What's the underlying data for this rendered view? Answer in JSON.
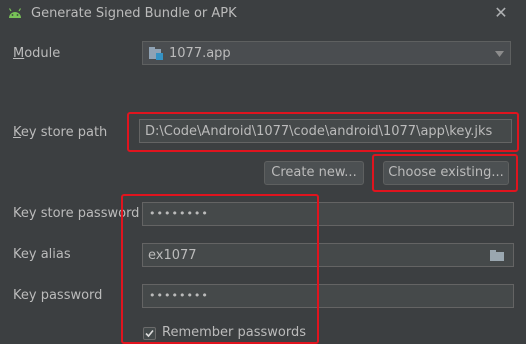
{
  "window": {
    "title": "Generate Signed Bundle or APK"
  },
  "module": {
    "label": "Module",
    "value": "1077.app"
  },
  "keystore": {
    "path_label": "Key store path",
    "path_value": "D:\\Code\\Android\\1077\\code\\android\\1077\\app\\key.jks",
    "create_new": "Create new...",
    "choose_existing": "Choose existing...",
    "password_label": "Key store password",
    "password_value": "••••••••"
  },
  "key": {
    "alias_label": "Key alias",
    "alias_value": "ex1077",
    "password_label": "Key password",
    "password_value": "••••••••"
  },
  "remember": {
    "label": "Remember passwords",
    "checked": true
  },
  "colors": {
    "background": "#3c3f41",
    "field": "#45494a",
    "highlight": "#e0141e",
    "android": "#78c257"
  },
  "icons": {
    "app": "android-icon",
    "close": "close-icon",
    "module": "module-folder-icon",
    "dropdown": "chevron-down-icon",
    "browse": "folder-icon",
    "check": "checkmark-icon"
  }
}
